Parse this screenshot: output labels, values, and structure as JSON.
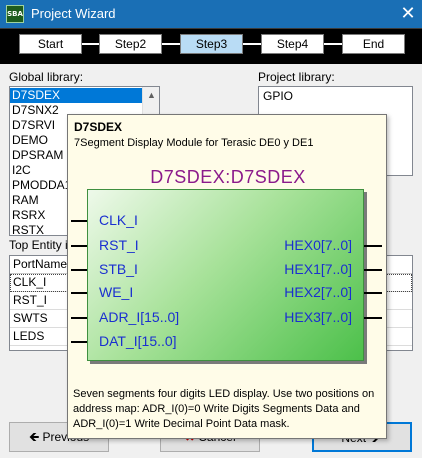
{
  "window": {
    "title": "Project Wizard",
    "icon_text": "SBA",
    "icon_name": "app-logo-icon",
    "close_glyph": "✕"
  },
  "steps": [
    {
      "label": "Start",
      "active": false
    },
    {
      "label": "Step2",
      "active": false
    },
    {
      "label": "Step3",
      "active": true
    },
    {
      "label": "Step4",
      "active": false
    },
    {
      "label": "End",
      "active": false
    }
  ],
  "global_library": {
    "label": "Global library:",
    "items": [
      "D7SDEX",
      "D7SNX2",
      "D7SRVI",
      "DEMO",
      "DPSRAM",
      "I2C",
      "PMODDA1",
      "RAM",
      "RSRX",
      "RSTX"
    ],
    "selected": "D7SDEX",
    "scroll_up_glyph": "▲"
  },
  "project_library": {
    "label": "Project library:",
    "items": [
      "GPIO"
    ]
  },
  "top_entity": {
    "label": "Top Entity i",
    "header": "PortName",
    "rows": [
      "CLK_I",
      "RST_I",
      "SWTS",
      "LEDS"
    ]
  },
  "buttons": {
    "previous": "Previous",
    "cancel": "Cancel",
    "next": "Next"
  },
  "tooltip": {
    "title": "D7SDEX",
    "subtitle": "7Segment Display Module for Terasic DE0 y DE1",
    "entity": "D7SDEX:D7SDEX",
    "inputs": [
      "CLK_I",
      "RST_I",
      "STB_I",
      "WE_I",
      "ADR_I[15..0]",
      "DAT_I[15..0]"
    ],
    "outputs": [
      "HEX0[7..0]",
      "HEX1[7..0]",
      "HEX2[7..0]",
      "HEX3[7..0]"
    ],
    "description": "Seven segments four digits LED display. Use two positions on address map: ADR_I(0)=0 Write Digits Segments Data and ADR_I(0)=1 Write Decimal Point Data mask."
  }
}
